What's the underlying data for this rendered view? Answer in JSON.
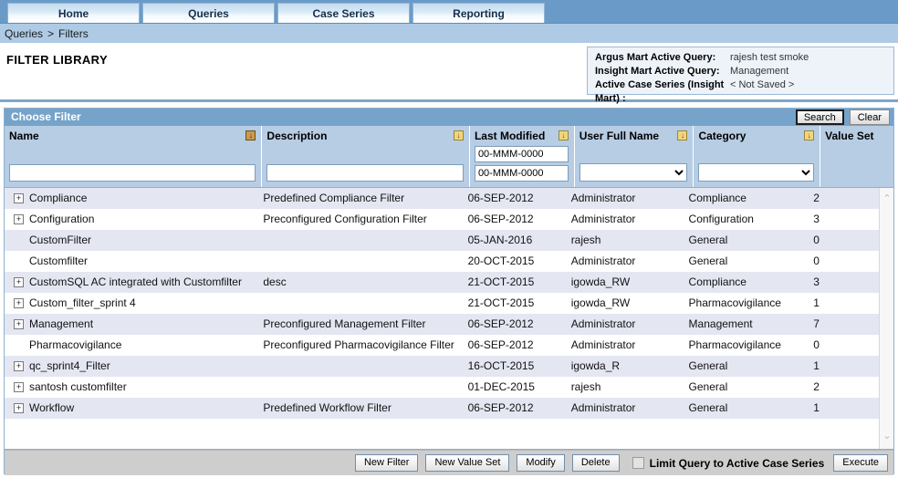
{
  "nav": {
    "tabs": [
      {
        "label": "Home"
      },
      {
        "label": "Queries"
      },
      {
        "label": "Case Series"
      },
      {
        "label": "Reporting"
      }
    ]
  },
  "breadcrumb": {
    "parent": "Queries",
    "separator": ">",
    "current": "Filters"
  },
  "page": {
    "title": "FILTER LIBRARY"
  },
  "info_box": {
    "rows": [
      {
        "label": "Argus Mart Active Query:",
        "value": "rajesh test smoke"
      },
      {
        "label": "Insight Mart Active Query:",
        "value": "Management"
      },
      {
        "label": "Active Case Series (Insight Mart) :",
        "value": "< Not Saved >"
      }
    ]
  },
  "panel": {
    "header": "Choose Filter",
    "search_label": "Search",
    "clear_label": "Clear"
  },
  "columns": [
    {
      "key": "name",
      "label": "Name",
      "sort_icon": "sort-down-icon",
      "sort_active": true
    },
    {
      "key": "description",
      "label": "Description",
      "sort_icon": "sort-down-icon",
      "sort_active": false
    },
    {
      "key": "last_modified",
      "label": "Last Modified",
      "sort_icon": "sort-down-icon",
      "sort_active": false
    },
    {
      "key": "user_full_name",
      "label": "User Full Name",
      "sort_icon": "sort-down-icon",
      "sort_active": false
    },
    {
      "key": "category",
      "label": "Category",
      "sort_icon": "sort-down-icon",
      "sort_active": false
    },
    {
      "key": "value_set",
      "label": "Value Set",
      "sort_icon": null,
      "sort_active": false
    }
  ],
  "filters": {
    "name_value": "",
    "description_value": "",
    "date_from_value": "00-MMM-0000",
    "date_to_value": "00-MMM-0000",
    "user_full_name_selected": "",
    "category_selected": ""
  },
  "rows": [
    {
      "expandable": true,
      "name": "Compliance",
      "description": "Predefined Compliance Filter",
      "last_modified": "06-SEP-2012",
      "user_full_name": "Administrator",
      "category": "Compliance",
      "value_set": "2"
    },
    {
      "expandable": true,
      "name": "Configuration",
      "description": "Preconfigured Configuration Filter",
      "last_modified": "06-SEP-2012",
      "user_full_name": "Administrator",
      "category": "Configuration",
      "value_set": "3"
    },
    {
      "expandable": false,
      "name": "CustomFilter",
      "description": "",
      "last_modified": "05-JAN-2016",
      "user_full_name": "rajesh",
      "category": "General",
      "value_set": "0"
    },
    {
      "expandable": false,
      "name": "Customfilter",
      "description": "",
      "last_modified": "20-OCT-2015",
      "user_full_name": "Administrator",
      "category": "General",
      "value_set": "0"
    },
    {
      "expandable": true,
      "name": "CustomSQL AC integrated with Customfilter",
      "description": "desc",
      "last_modified": "21-OCT-2015",
      "user_full_name": "igowda_RW",
      "category": "Compliance",
      "value_set": "3"
    },
    {
      "expandable": true,
      "name": "Custom_filter_sprint 4",
      "description": "",
      "last_modified": "21-OCT-2015",
      "user_full_name": "igowda_RW",
      "category": "Pharmacovigilance",
      "value_set": "1"
    },
    {
      "expandable": true,
      "name": "Management",
      "description": "Preconfigured Management Filter",
      "last_modified": "06-SEP-2012",
      "user_full_name": "Administrator",
      "category": "Management",
      "value_set": "7"
    },
    {
      "expandable": false,
      "name": "Pharmacovigilance",
      "description": "Preconfigured Pharmacovigilance Filter",
      "last_modified": "06-SEP-2012",
      "user_full_name": "Administrator",
      "category": "Pharmacovigilance",
      "value_set": "0"
    },
    {
      "expandable": true,
      "name": "qc_sprint4_Filter",
      "description": "",
      "last_modified": "16-OCT-2015",
      "user_full_name": "igowda_R",
      "category": "General",
      "value_set": "1"
    },
    {
      "expandable": true,
      "name": "santosh customfilter",
      "description": "",
      "last_modified": "01-DEC-2015",
      "user_full_name": "rajesh",
      "category": "General",
      "value_set": "2"
    },
    {
      "expandable": true,
      "name": "Workflow",
      "description": "Predefined Workflow Filter",
      "last_modified": "06-SEP-2012",
      "user_full_name": "Administrator",
      "category": "General",
      "value_set": "1"
    }
  ],
  "toolbar": {
    "new_filter": "New Filter",
    "new_value_set": "New Value Set",
    "modify": "Modify",
    "delete": "Delete",
    "limit_checkbox_label": "Limit Query to Active Case Series",
    "limit_checkbox_checked": false,
    "execute": "Execute"
  },
  "icons": {
    "expander_plus": "+",
    "sort_down": "↓",
    "scroll_up": "⌃",
    "scroll_down": "⌄"
  },
  "colors": {
    "nav_bg": "#6a9bc8",
    "breadcrumb_bg": "#aecae5",
    "panel_header_bg": "#76a3ca",
    "column_header_bg": "#b6cde4",
    "row_alt_bg": "#e4e7f2",
    "toolbar_bg": "#cecece"
  }
}
